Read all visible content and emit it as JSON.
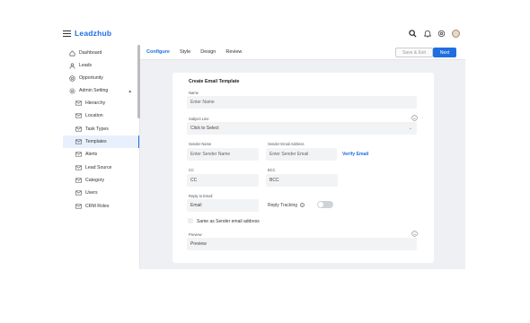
{
  "header": {
    "logo": "Leadzhub",
    "icons": [
      "search-icon",
      "bell-icon",
      "settings-icon",
      "avatar"
    ]
  },
  "sidebar": {
    "items": [
      {
        "label": "Dashboard",
        "icon": "home-icon"
      },
      {
        "label": "Leads",
        "icon": "user-icon"
      },
      {
        "label": "Opportunity",
        "icon": "opportunity-icon"
      },
      {
        "label": "Admin Setting",
        "icon": "gear-icon",
        "expanded": true
      }
    ],
    "sub_items": [
      {
        "label": "Hierarchy",
        "icon": "mail-icon"
      },
      {
        "label": "Location",
        "icon": "mail-icon"
      },
      {
        "label": "Task Types",
        "icon": "mail-icon"
      },
      {
        "label": "Templates",
        "icon": "mail-icon",
        "active": true
      },
      {
        "label": "Alerts",
        "icon": "mail-icon"
      },
      {
        "label": "Lead Source",
        "icon": "mail-icon"
      },
      {
        "label": "Category",
        "icon": "mail-icon"
      },
      {
        "label": "Users",
        "icon": "mail-icon"
      },
      {
        "label": "CRM Roles",
        "icon": "mail-icon"
      }
    ]
  },
  "tabs": [
    "Configure",
    "Style",
    "Design",
    "Review"
  ],
  "active_tab": "Configure",
  "buttons": {
    "save_exit": "Save & Exit",
    "next": "Next"
  },
  "form": {
    "title": "Create Email Template",
    "name": {
      "label": "Name",
      "placeholder": "Enter Name"
    },
    "subject": {
      "label": "Subject Line",
      "value": "Click to Select"
    },
    "sender_name": {
      "label": "Sender Name",
      "placeholder": "Enter Sender Name"
    },
    "sender_email": {
      "label": "Sender Email Address",
      "placeholder": "Enter Sender Email"
    },
    "verify_email": "Verify Email",
    "cc": {
      "label": "CC",
      "value": "CC"
    },
    "bcc": {
      "label": "BCC",
      "value": "BCC"
    },
    "reply_to": {
      "label": "Reply to Email",
      "value": "Email"
    },
    "reply_tracking": {
      "label": "Reply Tracking",
      "enabled": false
    },
    "same_as_sender": {
      "label": "Same as Sender email address",
      "checked": false
    },
    "preview": {
      "label": "Preview",
      "value": "Preview"
    }
  },
  "colors": {
    "accent": "#1f6fe0",
    "main_bg": "#eef0f3",
    "field_bg": "#f2f3f5"
  }
}
